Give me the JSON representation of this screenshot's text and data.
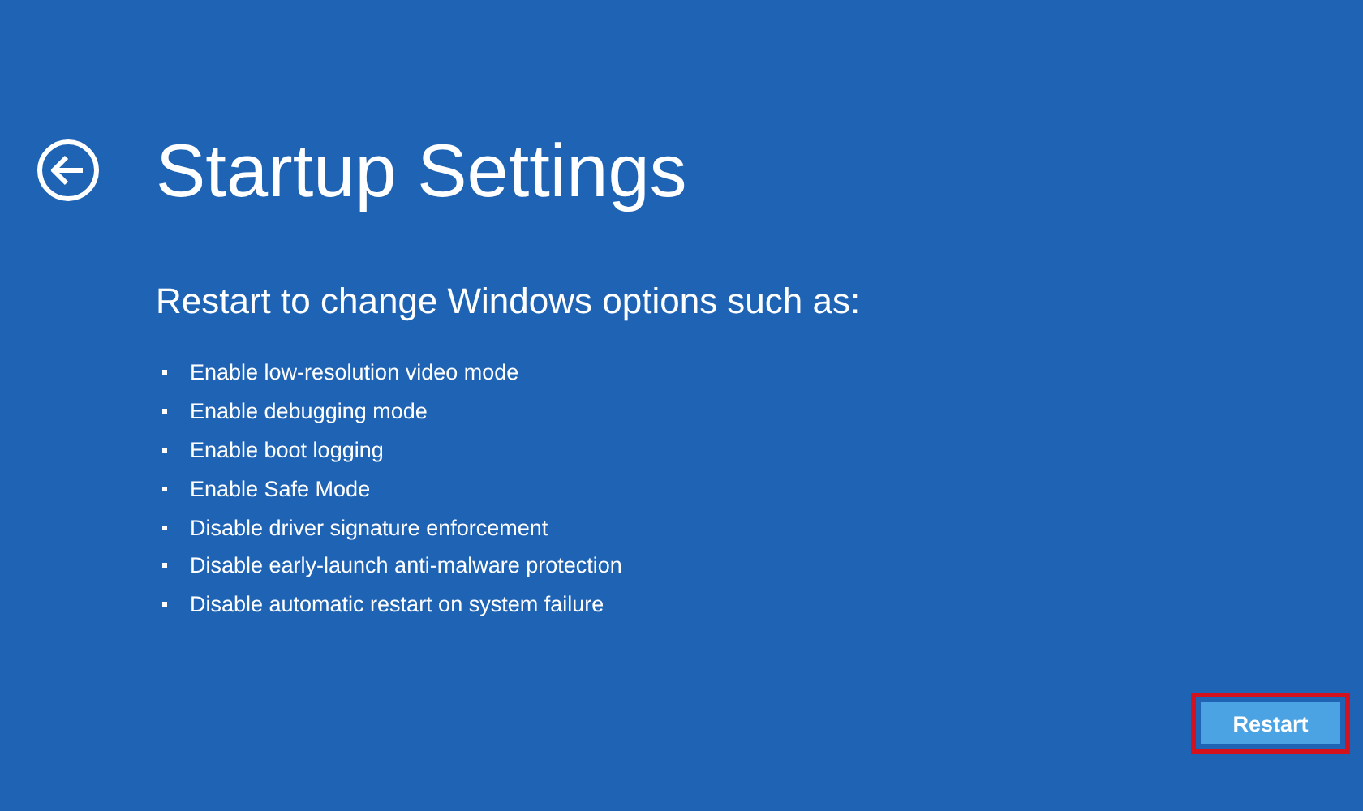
{
  "title": "Startup Settings",
  "subtitle": "Restart to change Windows options such as:",
  "options": [
    {
      "label": "Enable low-resolution video mode"
    },
    {
      "label": "Enable debugging mode"
    },
    {
      "label": "Enable boot logging"
    },
    {
      "label": "Enable Safe Mode"
    },
    {
      "label": "Disable driver signature enforcement"
    },
    {
      "label": "Disable early-launch anti-malware protection"
    },
    {
      "label": "Disable automatic restart on system failure"
    }
  ],
  "restart_button": {
    "label": "Restart",
    "highlighted": true
  }
}
